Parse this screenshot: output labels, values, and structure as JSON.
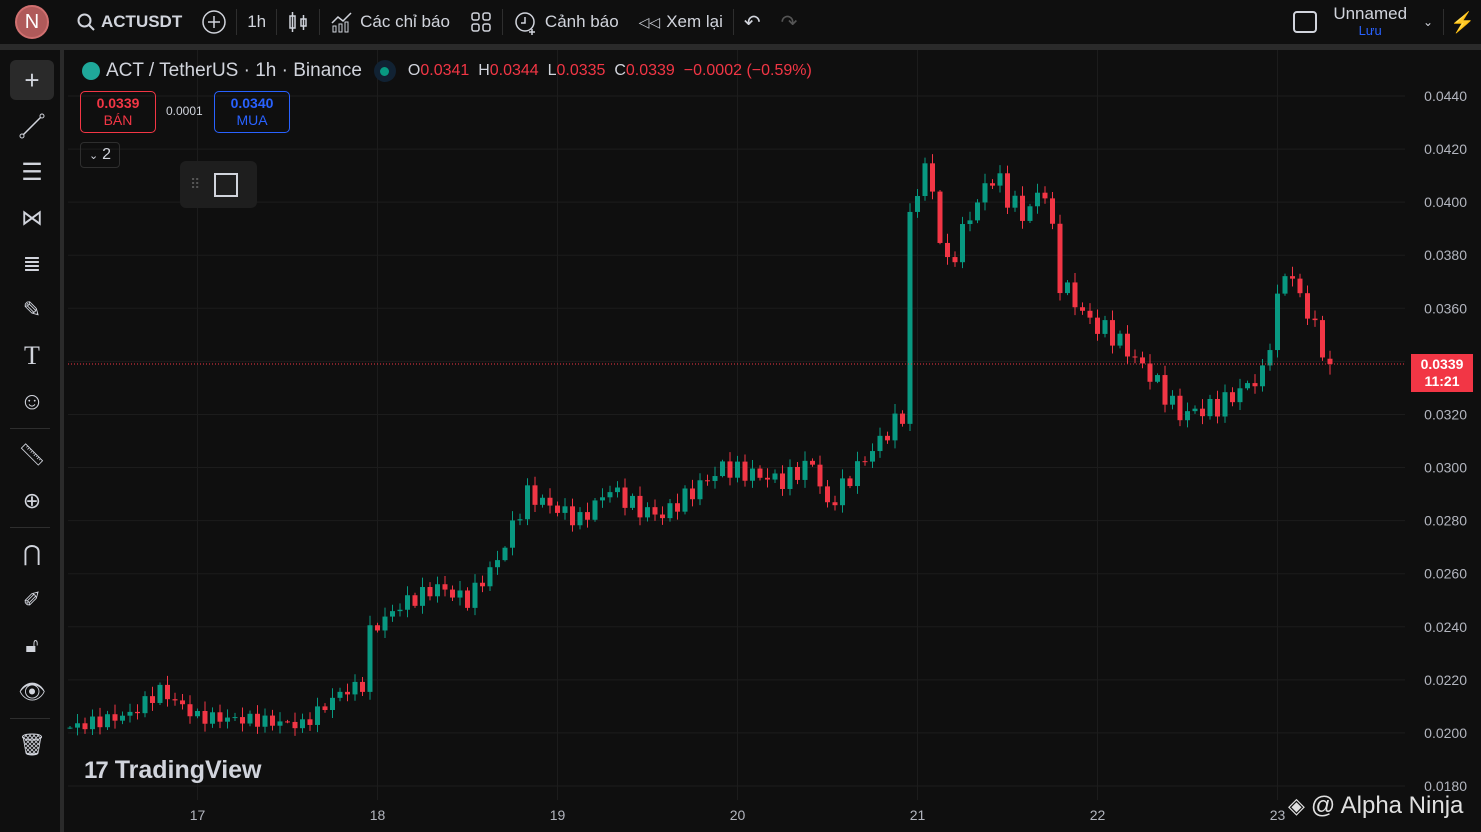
{
  "topbar": {
    "avatar": "N",
    "symbol": "ACTUSDT",
    "interval": "1h",
    "indicators": "Các chỉ báo",
    "alerts": "Cảnh báo",
    "replay": "Xem lại",
    "layout_name": "Unnamed",
    "save": "Lưu"
  },
  "legend": {
    "title": "ACT / TetherUS · 1h · Binance",
    "o_label": "O",
    "o": "0.0341",
    "h_label": "H",
    "h": "0.0344",
    "l_label": "L",
    "l": "0.0335",
    "c_label": "C",
    "c": "0.0339",
    "change": "−0.0002 (−0.59%)"
  },
  "trade": {
    "sell_price": "0.0339",
    "sell_label": "BÁN",
    "spread": "0.0001",
    "buy_price": "0.0340",
    "buy_label": "MUA"
  },
  "collapse": {
    "count": "2"
  },
  "watermark": "TradingView",
  "credit": "@ Alpha Ninja",
  "current_price": {
    "price": "0.0339",
    "countdown": "11:21"
  },
  "colors": {
    "up": "#089981",
    "down": "#f23645",
    "accent": "#2962ff"
  },
  "chart_data": {
    "type": "candlestick",
    "title": "ACT / TetherUS · 1h · Binance",
    "y_ticks": [
      "0.0440",
      "0.0420",
      "0.0400",
      "0.0380",
      "0.0360",
      "0.0340",
      "0.0320",
      "0.0300",
      "0.0280",
      "0.0260",
      "0.0240",
      "0.0220",
      "0.0200",
      "0.0180"
    ],
    "ylim": [
      0.018,
      0.044
    ],
    "x_ticks": [
      {
        "label": "17",
        "hour": 17
      },
      {
        "label": "18",
        "hour": 41
      },
      {
        "label": "19",
        "hour": 65
      },
      {
        "label": "20",
        "hour": 89
      },
      {
        "label": "21",
        "hour": 113
      },
      {
        "label": "22",
        "hour": 137
      },
      {
        "label": "23",
        "hour": 161
      }
    ],
    "close_keypoints": [
      [
        0,
        0.0202
      ],
      [
        8,
        0.0207
      ],
      [
        12,
        0.0216
      ],
      [
        17,
        0.0206
      ],
      [
        24,
        0.0205
      ],
      [
        31,
        0.0203
      ],
      [
        36,
        0.0215
      ],
      [
        39,
        0.0218
      ],
      [
        40,
        0.0238
      ],
      [
        44,
        0.0248
      ],
      [
        49,
        0.0255
      ],
      [
        53,
        0.025
      ],
      [
        57,
        0.0265
      ],
      [
        61,
        0.029
      ],
      [
        68,
        0.028
      ],
      [
        72,
        0.0292
      ],
      [
        76,
        0.0284
      ],
      [
        79,
        0.0282
      ],
      [
        87,
        0.03
      ],
      [
        95,
        0.0295
      ],
      [
        99,
        0.0302
      ],
      [
        101,
        0.0285
      ],
      [
        105,
        0.03
      ],
      [
        111,
        0.032
      ],
      [
        112,
        0.0393
      ],
      [
        114,
        0.0415
      ],
      [
        117,
        0.0375
      ],
      [
        120,
        0.0395
      ],
      [
        123,
        0.041
      ],
      [
        127,
        0.0395
      ],
      [
        130,
        0.0405
      ],
      [
        132,
        0.037
      ],
      [
        136,
        0.0355
      ],
      [
        139,
        0.035
      ],
      [
        144,
        0.0335
      ],
      [
        148,
        0.032
      ],
      [
        153,
        0.0323
      ],
      [
        159,
        0.0335
      ],
      [
        162,
        0.0375
      ],
      [
        164,
        0.0365
      ],
      [
        168,
        0.0339
      ]
    ],
    "last_candle": {
      "open": 0.0341,
      "high": 0.0344,
      "low": 0.0335,
      "close": 0.0339
    }
  }
}
